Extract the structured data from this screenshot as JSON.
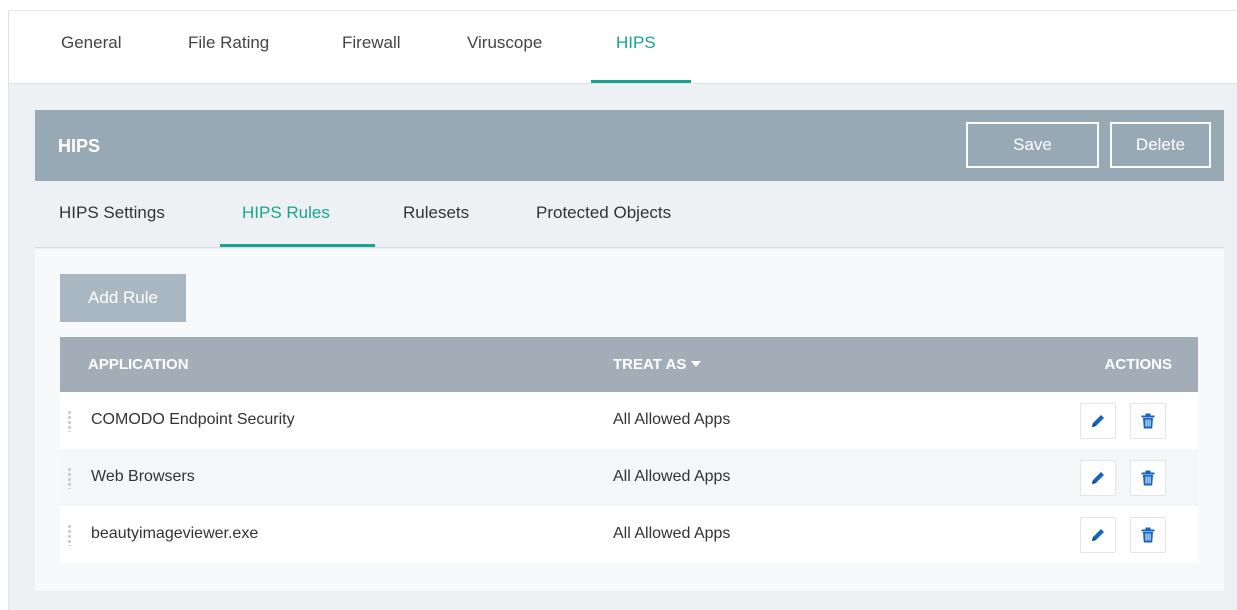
{
  "top_tabs": [
    {
      "label": "General"
    },
    {
      "label": "File Rating"
    },
    {
      "label": "Firewall"
    },
    {
      "label": "Viruscope"
    },
    {
      "label": "HIPS",
      "active": true
    }
  ],
  "panel": {
    "title": "HIPS",
    "save_label": "Save",
    "delete_label": "Delete"
  },
  "sub_tabs": [
    {
      "label": "HIPS Settings"
    },
    {
      "label": "HIPS Rules",
      "active": true
    },
    {
      "label": "Rulesets"
    },
    {
      "label": "Protected Objects"
    }
  ],
  "add_rule_label": "Add Rule",
  "table": {
    "columns": {
      "application": "APPLICATION",
      "treat_as": "TREAT AS",
      "actions": "ACTIONS"
    },
    "rows": [
      {
        "application": "COMODO Endpoint Security",
        "treat_as": "All Allowed Apps"
      },
      {
        "application": "Web Browsers",
        "treat_as": "All Allowed Apps"
      },
      {
        "application": "beautyimageviewer.exe",
        "treat_as": "All Allowed Apps"
      }
    ]
  },
  "icons": {
    "edit": "pencil-icon",
    "delete": "trash-icon",
    "sort": "caret-down-icon",
    "drag": "drag-handle-icon"
  },
  "colors": {
    "accent": "#1aa390",
    "header_bar": "#98a9b6",
    "table_header": "#a3adb7",
    "action_icon": "#1565c0"
  }
}
